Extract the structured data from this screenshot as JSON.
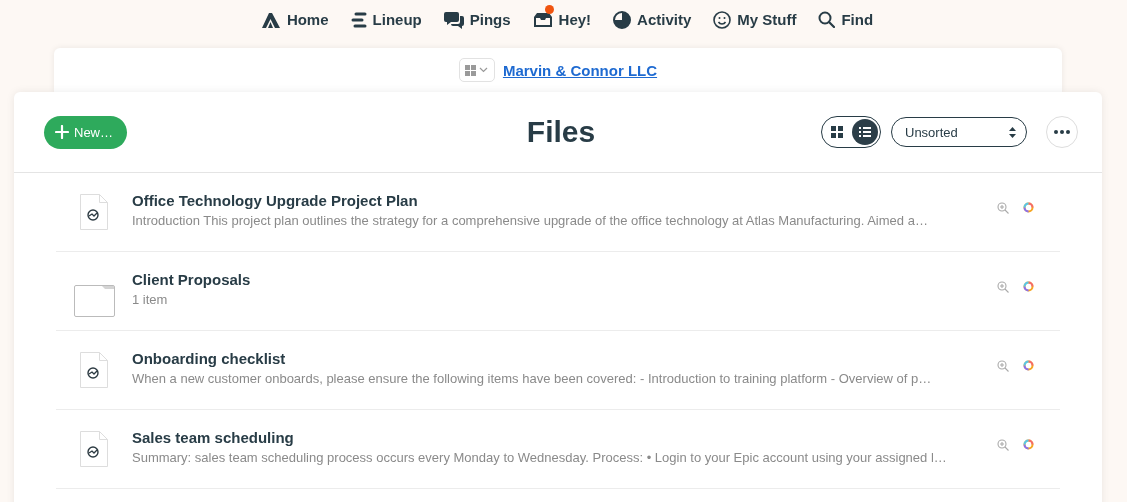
{
  "nav": [
    {
      "label": "Home",
      "badge": false
    },
    {
      "label": "Lineup",
      "badge": false
    },
    {
      "label": "Pings",
      "badge": false
    },
    {
      "label": "Hey!",
      "badge": true
    },
    {
      "label": "Activity",
      "badge": false
    },
    {
      "label": "My Stuff",
      "badge": false
    },
    {
      "label": "Find",
      "badge": false
    }
  ],
  "project": {
    "name": "Marvin & Connor LLC"
  },
  "toolbar": {
    "new_button": "New…",
    "title": "Files",
    "views": [
      {
        "kind": "grid",
        "selected": false
      },
      {
        "kind": "list",
        "selected": true
      }
    ],
    "sort": "Unsorted"
  },
  "files": [
    {
      "kind": "document",
      "title": "Office Technology Upgrade Project Plan",
      "subtitle": "Introduction This project plan outlines the strategy for a comprehensive upgrade of the office technology at Atlas Manufacturing. Aimed a…"
    },
    {
      "kind": "folder",
      "title": "Client Proposals",
      "subtitle": "1 item"
    },
    {
      "kind": "document",
      "title": "Onboarding checklist",
      "subtitle": "When a new customer onboards, please ensure the following items have been covered: - Introduction to training platform - Overview of p…"
    },
    {
      "kind": "document",
      "title": "Sales team scheduling",
      "subtitle": "Summary: sales team scheduling process occurs every Monday to Wednesday. Process: • Login to your Epic account using your assigned l…"
    }
  ]
}
